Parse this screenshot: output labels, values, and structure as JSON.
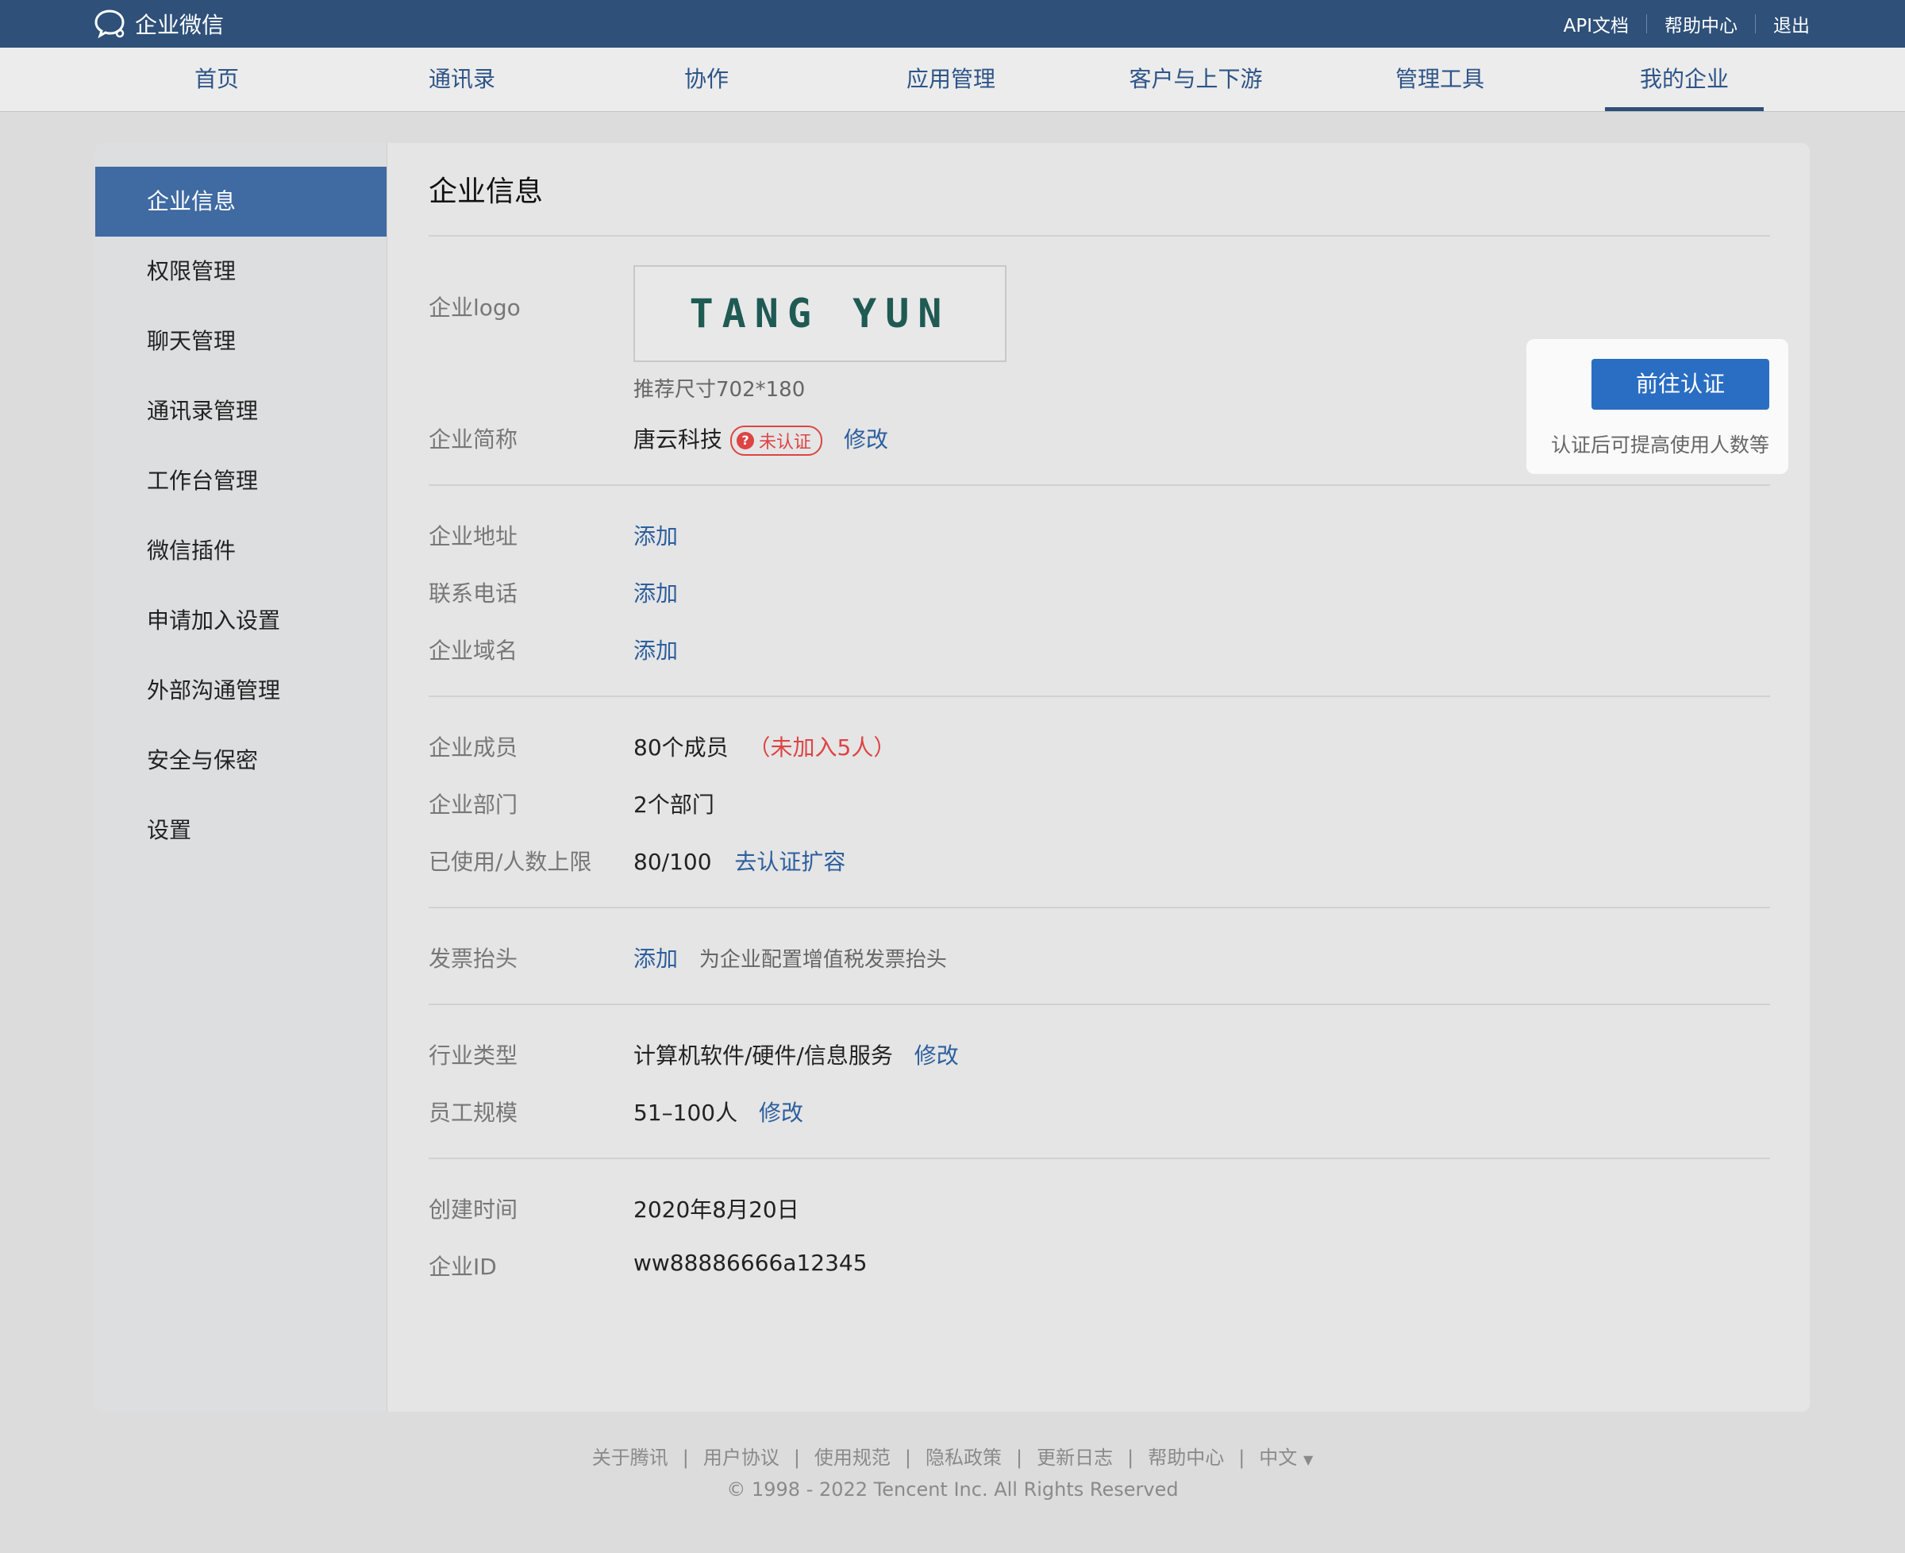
{
  "topbar": {
    "brand": "企业微信",
    "links": [
      "API文档",
      "帮助中心",
      "退出"
    ]
  },
  "nav": {
    "tabs": [
      "首页",
      "通讯录",
      "协作",
      "应用管理",
      "客户与上下游",
      "管理工具",
      "我的企业"
    ],
    "active": "我的企业"
  },
  "sidebar": {
    "items": [
      "企业信息",
      "权限管理",
      "聊天管理",
      "通讯录管理",
      "工作台管理",
      "微信插件",
      "申请加入设置",
      "外部沟通管理",
      "安全与保密",
      "设置"
    ],
    "active": "企业信息"
  },
  "main": {
    "title": "企业信息",
    "logo": {
      "label": "企业logo",
      "text": "TANG YUN",
      "hint": "推荐尺寸702*180"
    },
    "short_name": {
      "label": "企业简称",
      "value": "唐云科技",
      "badge": "未认证",
      "action": "修改"
    },
    "address": {
      "label": "企业地址",
      "action": "添加"
    },
    "phone": {
      "label": "联系电话",
      "action": "添加"
    },
    "domain": {
      "label": "企业域名",
      "action": "添加"
    },
    "members": {
      "label": "企业成员",
      "value": "80个成员",
      "extra": "（未加入5人）"
    },
    "departments": {
      "label": "企业部门",
      "value": "2个部门"
    },
    "usage": {
      "label": "已使用/人数上限",
      "value": "80/100",
      "action": "去认证扩容"
    },
    "invoice": {
      "label": "发票抬头",
      "action": "添加",
      "hint": "为企业配置增值税发票抬头"
    },
    "industry": {
      "label": "行业类型",
      "value": "计算机软件/硬件/信息服务",
      "action": "修改"
    },
    "scale": {
      "label": "员工规模",
      "value": "51–100人",
      "action": "修改"
    },
    "created": {
      "label": "创建时间",
      "value": "2020年8月20日"
    },
    "corp_id": {
      "label": "企业ID",
      "value": "ww88886666a12345"
    }
  },
  "cert": {
    "button": "前往认证",
    "note": "认证后可提高使用人数等"
  },
  "footer": {
    "links": [
      "关于腾讯",
      "用户协议",
      "使用规范",
      "隐私政策",
      "更新日志",
      "帮助中心"
    ],
    "language": "中文",
    "copyright": "© 1998 - 2022 Tencent Inc. All Rights Reserved"
  },
  "colors": {
    "topbar": "#2e5079",
    "accent": "#2a6ec3",
    "link": "#2d5f9e",
    "warning": "#dd4444"
  }
}
